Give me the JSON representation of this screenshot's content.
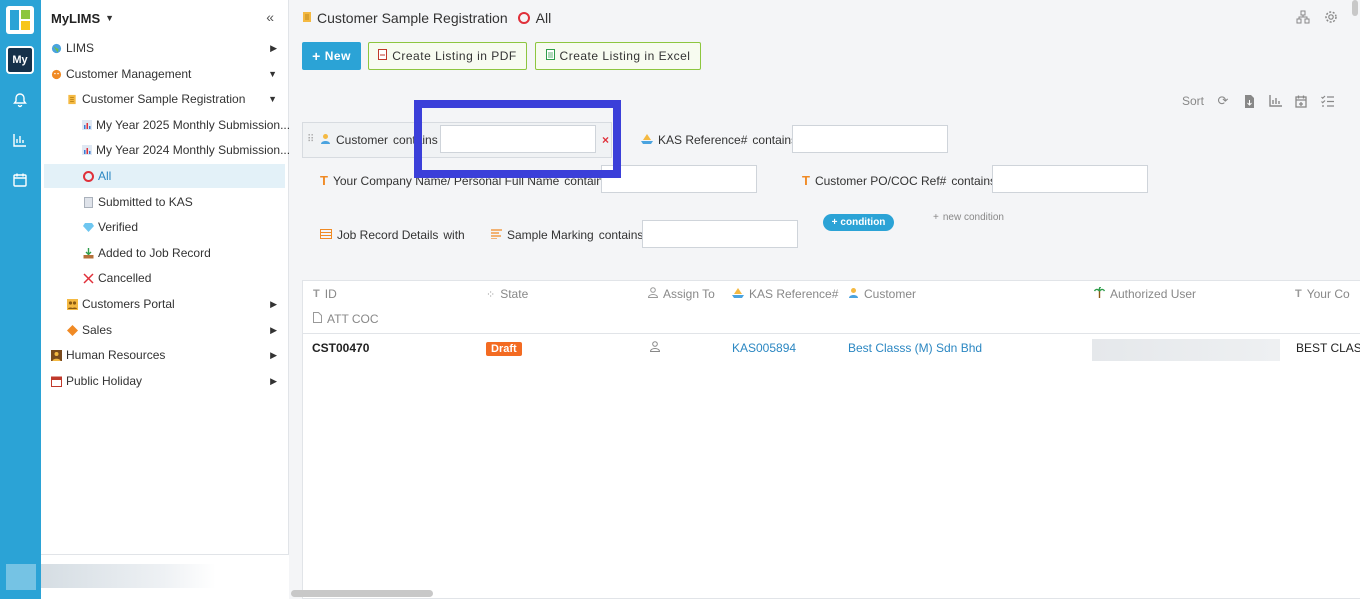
{
  "app": {
    "title": "MyLIMS",
    "rail_badge": "My"
  },
  "sidebar": {
    "items": [
      {
        "label": "LIMS"
      },
      {
        "label": "Customer Management"
      },
      {
        "label": "Customer Sample Registration"
      },
      {
        "label": "My Year 2025 Monthly Submission..."
      },
      {
        "label": "My Year 2024 Monthly Submission..."
      },
      {
        "label": "All"
      },
      {
        "label": "Submitted to KAS"
      },
      {
        "label": "Verified"
      },
      {
        "label": "Added to Job Record"
      },
      {
        "label": "Cancelled"
      },
      {
        "label": "Customers Portal"
      },
      {
        "label": "Sales"
      },
      {
        "label": "Human Resources"
      },
      {
        "label": "Public Holiday"
      }
    ]
  },
  "header": {
    "title": "Customer Sample Registration",
    "view": "All"
  },
  "toolbar": {
    "new_label": "New",
    "pdf_label": "Create Listing in PDF",
    "excel_label": "Create Listing in Excel",
    "sort_label": "Sort"
  },
  "filters": {
    "customer": {
      "field": "Customer",
      "op": "contains",
      "value": ""
    },
    "kas_ref": {
      "field": "KAS Reference#",
      "op": "contains",
      "value": ""
    },
    "company": {
      "field": "Your Company Name/ Personal Full Name",
      "op": "contains",
      "value": ""
    },
    "po_ref": {
      "field": "Customer PO/COC Ref#",
      "op": "contains",
      "value": ""
    },
    "job_record": {
      "field": "Job Record Details",
      "op": "with"
    },
    "marking": {
      "field": "Sample Marking",
      "op": "contains",
      "value": ""
    },
    "condition_label": "condition",
    "new_condition_label": "new condition"
  },
  "table": {
    "columns": [
      "ID",
      "State",
      "Assign To",
      "KAS Reference#",
      "Customer",
      "Authorized User",
      "Your Co",
      "ATT COC"
    ],
    "rows": [
      {
        "id": "CST00470",
        "state": "Draft",
        "kas_ref": "KAS005894",
        "customer": "Best Classs (M) Sdn Bhd",
        "your_co": "BEST CLAS"
      }
    ]
  },
  "colors": {
    "accent": "#2ba3d6",
    "draft": "#f36b22",
    "highlight": "#3b3fd9",
    "excel_border": "#8dc63f"
  }
}
